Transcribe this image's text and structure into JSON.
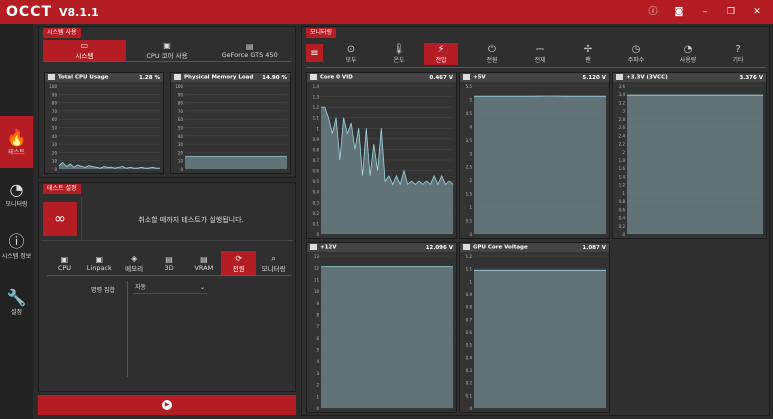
{
  "app": {
    "logo": "OCCT",
    "version": "V8.1.1"
  },
  "sidebar": [
    {
      "label": "테스트",
      "icon": "flame-icon",
      "active": true
    },
    {
      "label": "모니터링",
      "icon": "gauge-icon"
    },
    {
      "label": "시스템 정보",
      "icon": "info-icon"
    },
    {
      "label": "설정",
      "icon": "wrench-icon"
    }
  ],
  "system": {
    "title": "시스템 사용",
    "tabs": [
      "시스템",
      "CPU 코어 사용",
      "GeForce GTS 450"
    ],
    "graphs": [
      {
        "title": "Total CPU Usage",
        "value": "1.28 %"
      },
      {
        "title": "Physical Memory Load",
        "value": "14.90 %"
      }
    ]
  },
  "testset": {
    "title": "테스트 설정",
    "message": "취소할 때까지 테스트가 실행됩니다.",
    "tabs": [
      "CPU",
      "Linpack",
      "메모리",
      "3D",
      "VRAM",
      "전원",
      "모니터링"
    ],
    "option_label": "명령 집합",
    "option_value": "자동"
  },
  "monitor": {
    "title": "모니터링",
    "tabs": [
      "모두",
      "온도",
      "전압",
      "전원",
      "전재",
      "팬",
      "주파수",
      "사용량",
      "기타"
    ],
    "graphs": [
      {
        "title": "Core 0 VID",
        "value": "0.467 V"
      },
      {
        "title": "+5V",
        "value": "5.120 V"
      },
      {
        "title": "+3.3V (3VCC)",
        "value": "3.376 V"
      },
      {
        "title": "+12V",
        "value": "12.096 V"
      },
      {
        "title": "GPU Core Voltage",
        "value": "1.087 V"
      }
    ]
  },
  "colors": {
    "accent": "#b51d24",
    "line": "#9dd4e2"
  },
  "chart_data": [
    {
      "type": "line",
      "title": "Total CPU Usage",
      "ylim": [
        0,
        100
      ],
      "ticks": [
        "100",
        "90",
        "80",
        "70",
        "60",
        "50",
        "40",
        "30",
        "20",
        "10",
        "0"
      ],
      "values": [
        4,
        8,
        3,
        6,
        2,
        5,
        3,
        2,
        4,
        3,
        2,
        1,
        3,
        2,
        2,
        1,
        2,
        3,
        1,
        2,
        1,
        1,
        2,
        1,
        1,
        2,
        1,
        1
      ]
    },
    {
      "type": "line",
      "title": "Physical Memory Load",
      "ylim": [
        0,
        100
      ],
      "ticks": [
        "100",
        "90",
        "80",
        "70",
        "60",
        "50",
        "40",
        "30",
        "20",
        "10",
        "0"
      ],
      "values": [
        14.9,
        14.9,
        14.9,
        14.9,
        14.9,
        14.9,
        14.9,
        14.9,
        14.9,
        14.9
      ]
    },
    {
      "type": "line",
      "title": "Core 0 VID",
      "ylim": [
        0,
        1.4
      ],
      "ticks": [
        "1.4",
        "1.3",
        "1.2",
        "1.1",
        "1",
        "0.9",
        "0.8",
        "0.7",
        "0.6",
        "0.5",
        "0.4",
        "0.3",
        "0.2",
        "0.1",
        "0"
      ],
      "values": [
        1.2,
        1.2,
        1.1,
        0.95,
        1.1,
        0.7,
        1.1,
        0.95,
        1.05,
        0.8,
        1.0,
        0.55,
        1.0,
        0.55,
        0.85,
        0.6,
        1.0,
        0.5,
        0.55,
        0.47,
        0.55,
        0.47,
        0.6,
        0.47,
        0.5,
        0.47,
        0.5,
        0.47,
        0.5,
        0.47,
        0.55,
        0.47,
        0.55,
        0.47,
        0.5,
        0.47
      ]
    },
    {
      "type": "line",
      "title": "+5V",
      "ylim": [
        0,
        5.5
      ],
      "ticks": [
        "5.5",
        "5",
        "4.5",
        "4",
        "3.5",
        "3",
        "2.5",
        "2",
        "1.5",
        "1",
        "0.5",
        "0"
      ],
      "values": [
        5.12,
        5.12,
        5.12,
        5.12,
        5.13,
        5.12,
        5.12,
        5.12
      ]
    },
    {
      "type": "line",
      "title": "+3.3V (3VCC)",
      "ylim": [
        0,
        3.6
      ],
      "ticks": [
        "3.6",
        "3.4",
        "3.2",
        "3",
        "2.8",
        "2.6",
        "2.4",
        "2.2",
        "2",
        "1.8",
        "1.6",
        "1.4",
        "1.2",
        "1",
        "0.8",
        "0.6",
        "0.4",
        "0.2",
        "0"
      ],
      "values": [
        3.376,
        3.376,
        3.376,
        3.376,
        3.376,
        3.376
      ]
    },
    {
      "type": "line",
      "title": "+12V",
      "ylim": [
        0,
        13
      ],
      "ticks": [
        "13",
        "12",
        "11",
        "10",
        "9",
        "8",
        "7",
        "6",
        "5",
        "4",
        "3",
        "2",
        "1",
        "0"
      ],
      "values": [
        12.096,
        12.096,
        12.096,
        12.096,
        12.096,
        12.096
      ]
    },
    {
      "type": "line",
      "title": "GPU Core Voltage",
      "ylim": [
        0,
        1.2
      ],
      "ticks": [
        "1.2",
        "1.1",
        "1",
        "0.9",
        "0.8",
        "0.7",
        "0.6",
        "0.5",
        "0.4",
        "0.3",
        "0.2",
        "0.1",
        "0"
      ],
      "values": [
        1.087,
        1.087,
        1.087,
        1.087,
        1.087,
        1.087
      ]
    }
  ]
}
